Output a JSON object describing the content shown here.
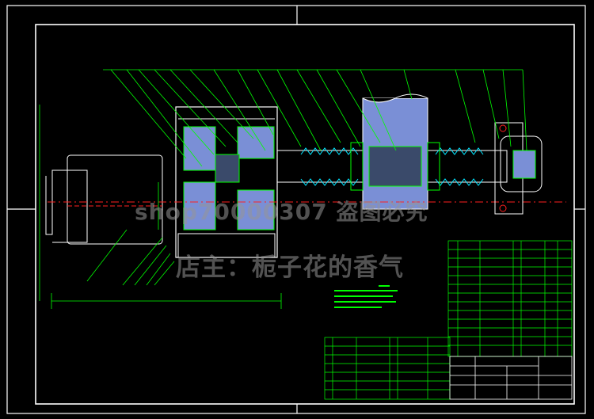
{
  "watermark": {
    "line1": "shop70000307  盗图必究",
    "line2": "店主：栀子花的香气"
  },
  "colors": {
    "background": "#000000",
    "frame": "#ffffff",
    "lines": "#00ff00",
    "accent_red": "#ff2020",
    "accent_cyan": "#00e5ff",
    "accent_magenta": "#ff40ff",
    "section_fill": "#7a8fd6"
  }
}
